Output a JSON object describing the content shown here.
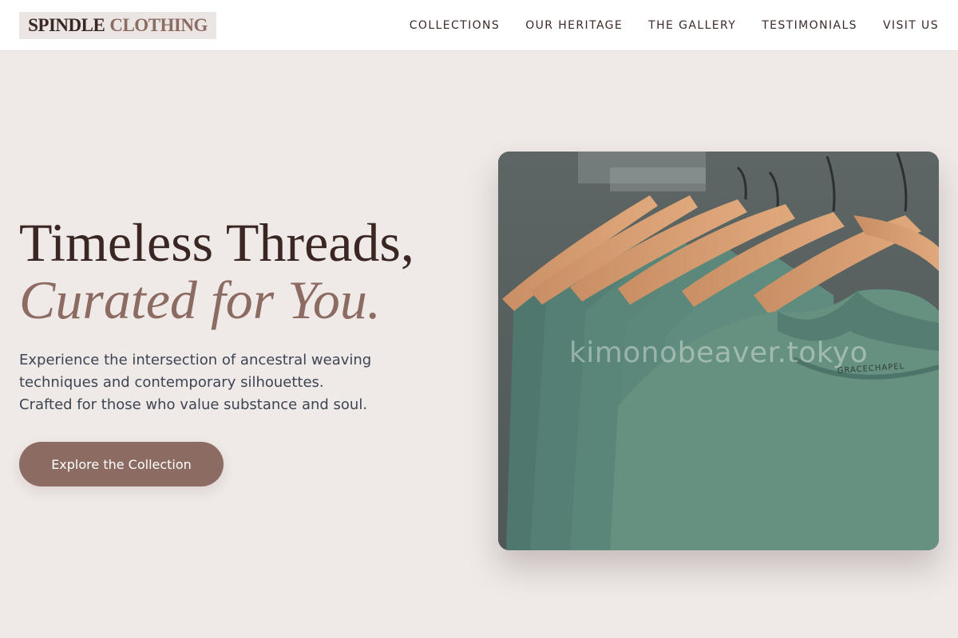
{
  "brand": {
    "name_part1": "SPINDLE",
    "name_part2": "CLOTHING"
  },
  "nav": {
    "items": [
      {
        "label": "COLLECTIONS"
      },
      {
        "label": "OUR HERITAGE"
      },
      {
        "label": "THE GALLERY"
      },
      {
        "label": "TESTIMONIALS"
      },
      {
        "label": "VISIT US"
      }
    ]
  },
  "hero": {
    "title_line1": "Timeless Threads,",
    "title_line2": "Curated for You.",
    "description_lines": [
      "Experience the intersection of ancestral weaving",
      "techniques and contemporary silhouettes.",
      "Crafted for those who value substance and soul."
    ],
    "cta_label": "Explore the Collection",
    "image": {
      "subject": "green t-shirts on wooden hangers",
      "watermark": "kimonobeaver.tokyo",
      "label_text": "GRACECHAPEL"
    }
  },
  "colors": {
    "page_background": "#efe9e8",
    "brand_dark": "#3a2622",
    "accent": "#8c6b62",
    "body_text": "#3d4452",
    "shirt_green": "#5f8a7e"
  }
}
